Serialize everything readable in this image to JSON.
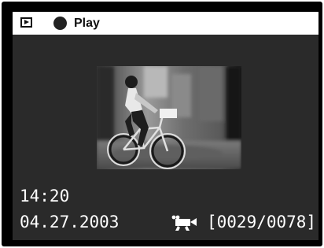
{
  "header": {
    "mode_icon": "playback-mode-icon",
    "status_icon": "filled-circle-icon",
    "title": "Play"
  },
  "image": {
    "subject": "woman-riding-bicycle-photo"
  },
  "info": {
    "time": "14:20",
    "date": "04.27.2003",
    "media_icon": "movie-camera-icon",
    "counter": "[0029/0078]"
  },
  "colors": {
    "screen_bg": "#2a2a2a",
    "header_bg": "#ffffff",
    "text": "#ffffff"
  }
}
